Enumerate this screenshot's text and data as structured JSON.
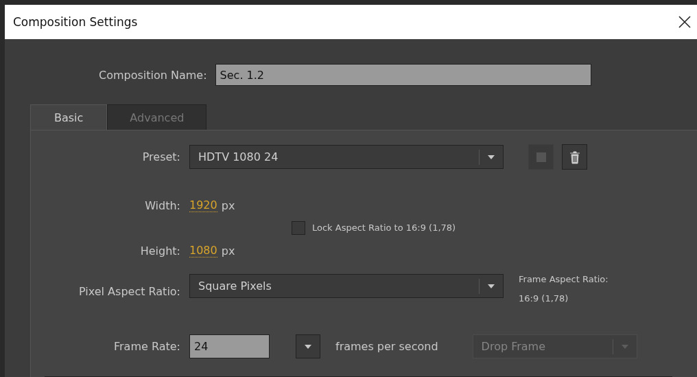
{
  "window": {
    "title": "Composition Settings"
  },
  "composition_name": {
    "label": "Composition Name:",
    "value": "Sec. 1.2"
  },
  "tabs": [
    {
      "label": "Basic",
      "selected": true
    },
    {
      "label": "Advanced",
      "selected": false
    }
  ],
  "preset": {
    "label": "Preset:",
    "value": "HDTV 1080 24"
  },
  "width": {
    "label": "Width:",
    "value": "1920",
    "unit": "px"
  },
  "height": {
    "label": "Height:",
    "value": "1080",
    "unit": "px"
  },
  "lock_aspect": {
    "label": "Lock Aspect Ratio to 16:9 (1,78)",
    "checked": false
  },
  "pixel_aspect": {
    "label": "Pixel Aspect Ratio:",
    "value": "Square Pixels"
  },
  "frame_aspect": {
    "label": "Frame Aspect Ratio:",
    "value": "16:9 (1,78)"
  },
  "frame_rate": {
    "label": "Frame Rate:",
    "value": "24",
    "unit": "frames per second"
  },
  "drop_frame": {
    "value": "Drop Frame",
    "disabled": true
  }
}
